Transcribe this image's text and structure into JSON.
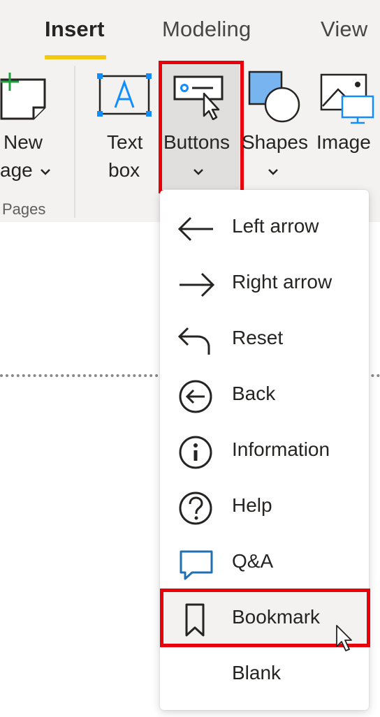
{
  "ribbon": {
    "tabs": [
      {
        "label": "Insert",
        "active": true
      },
      {
        "label": "Modeling",
        "active": false
      },
      {
        "label": "View",
        "active": false
      }
    ],
    "new_page": {
      "line1": "New",
      "line2": "age"
    },
    "pages_group_label": "Pages",
    "text_box": {
      "line1": "Text",
      "line2": "box"
    },
    "buttons": {
      "label": "Buttons"
    },
    "shapes": {
      "label": "Shapes"
    },
    "image": {
      "label": "Image"
    }
  },
  "buttons_menu": {
    "items": [
      {
        "label": "Left arrow",
        "icon": "left-arrow-icon"
      },
      {
        "label": "Right arrow",
        "icon": "right-arrow-icon"
      },
      {
        "label": "Reset",
        "icon": "reset-icon"
      },
      {
        "label": "Back",
        "icon": "back-icon"
      },
      {
        "label": "Information",
        "icon": "information-icon"
      },
      {
        "label": "Help",
        "icon": "help-icon"
      },
      {
        "label": "Q&A",
        "icon": "qna-icon"
      },
      {
        "label": "Bookmark",
        "icon": "bookmark-icon",
        "hovered": true
      },
      {
        "label": "Blank",
        "icon": ""
      }
    ]
  },
  "colors": {
    "accent_underline": "#f2c811",
    "highlight_red": "#e8000b",
    "icon_blue": "#118dff",
    "qna_blue": "#1f6fb2"
  }
}
